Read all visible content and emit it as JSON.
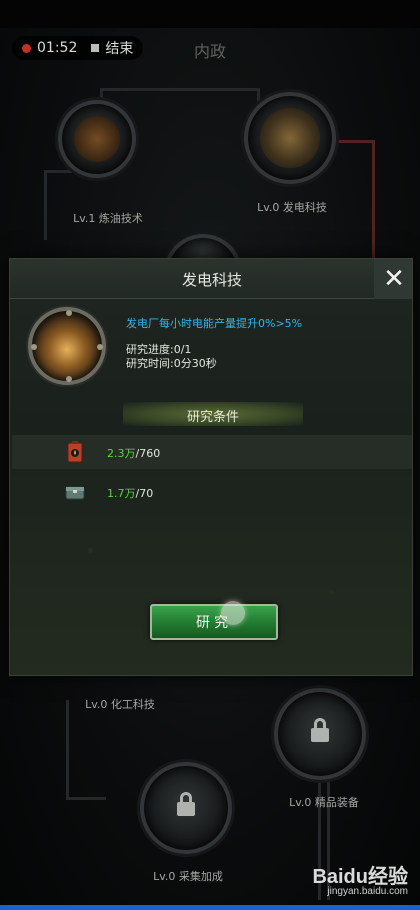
{
  "recorder": {
    "time": "01:52",
    "stop_label": "结束"
  },
  "header": {
    "title": "内政"
  },
  "tech_nodes": [
    {
      "label": "Lv.1 炼油技术",
      "locked": false
    },
    {
      "label": "Lv.0 发电科技",
      "locked": false
    },
    {
      "label": "Lv.0 化工科技",
      "locked": false
    },
    {
      "label": "Lv.0 精品装备",
      "locked": true
    },
    {
      "label": "Lv.0 采集加成",
      "locked": true
    }
  ],
  "modal": {
    "title": "发电科技",
    "close_icon": "✕",
    "description": "发电厂每小时电能产量提升0%>5%",
    "progress_label": "研究进度",
    "progress_value": ":0/1",
    "time_label": "研究时间",
    "time_value": ":0分30秒",
    "conditions_title": "研究条件",
    "requirements": [
      {
        "icon": "oil-barrel-icon",
        "have": "2.3万",
        "need": "/760"
      },
      {
        "icon": "supply-crate-icon",
        "have": "1.7万",
        "need": "/70"
      }
    ],
    "research_button": "研究"
  },
  "watermark": {
    "logo": "Baidu经验",
    "url": "jingyan.baidu.com"
  },
  "colors": {
    "accent_blue": "#35b4e8",
    "have_green": "#5fd24a",
    "button_green": "#2a8a39"
  }
}
